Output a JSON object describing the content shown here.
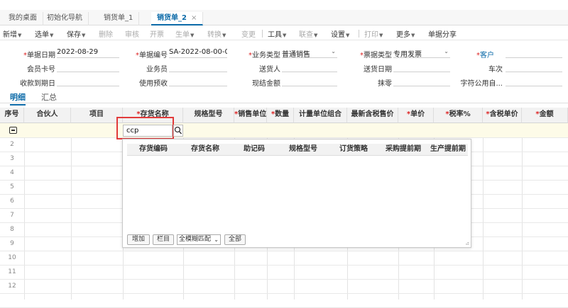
{
  "tabs": {
    "items": [
      {
        "label": "我的桌面"
      },
      {
        "label": "初始化导航"
      },
      {
        "label": "销货单_1"
      },
      {
        "label": "销货单_2",
        "close": "×"
      }
    ]
  },
  "toolbar": {
    "new": "新增",
    "select": "选单",
    "save": "保存",
    "delete": "删除",
    "audit": "审核",
    "invoice": "开票",
    "generate": "生单",
    "convert": "转换",
    "change": "变更",
    "tools": "工具",
    "link": "联查",
    "settings": "设置",
    "print": "打印",
    "more": "更多",
    "share": "单据分享"
  },
  "form": {
    "date_label": "单据日期",
    "date_value": "2022-08-29",
    "docno_label": "单据编号",
    "docno_value": "SA-2022-08-00-0...",
    "biztype_label": "业务类型",
    "biztype_value": "普通销售",
    "billtype_label": "票据类型",
    "billtype_value": "专用发票",
    "customer_label": "客户",
    "card_label": "会员卡号",
    "salesman_label": "业务员",
    "shipper_label": "送货人",
    "deliverydate_label": "送货日期",
    "vehicle_label": "车次",
    "duedate_label": "收款到期日",
    "prepay_label": "使用预收",
    "cash_label": "现结金额",
    "round_label": "抹零",
    "charpublic_label": "字符公用自..."
  },
  "subtabs": {
    "detail": "明细",
    "summary": "汇总"
  },
  "grid": {
    "columns": [
      "序号",
      "合伙人",
      "项目",
      "存货名称",
      "规格型号",
      "销售单位",
      "数量",
      "计量单位组合",
      "最新含税售价",
      "单价",
      "税率%",
      "含税单价",
      "金额"
    ],
    "required": [
      "存货名称",
      "销售单位",
      "数量",
      "单价",
      "税率%",
      "含税单价",
      "金额"
    ],
    "rows": [
      "2",
      "3",
      "4",
      "5",
      "6",
      "7",
      "8",
      "9",
      "10",
      "11",
      "12"
    ]
  },
  "editor": {
    "value": "ccp"
  },
  "popup": {
    "columns": [
      "存货编码",
      "存货名称",
      "助记码",
      "规格型号",
      "订货策略",
      "采购提前期",
      "生产提前期"
    ],
    "add": "增加",
    "columns_btn": "栏目",
    "match_mode": "全模糊匹配",
    "all": "全部"
  }
}
